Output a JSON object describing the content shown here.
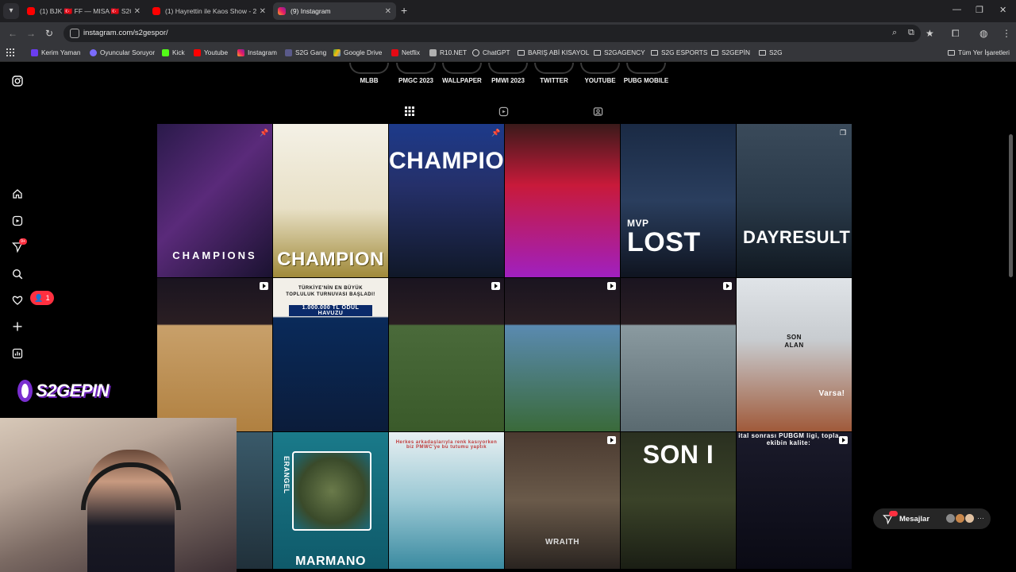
{
  "browser": {
    "tabs": [
      {
        "label": "(1) BJK 🇹🇷 FF — MISA 🇹🇷 S2G"
      },
      {
        "label": "(1) Hayrettin ile Kaos Show - 2."
      },
      {
        "label": "(9) Instagram"
      }
    ],
    "url": "instagram.com/s2gespor/",
    "bookmarks": [
      "Kerim Yaman",
      "Oyuncular Soruyor",
      "Kick",
      "Youtube",
      "Instagram",
      "S2G Gang",
      "Google Drive",
      "Netflix",
      "R10.NET",
      "ChatGPT",
      "BARIŞ ABİ KISAYOL",
      "S2GAGENCY",
      "S2G ESPORTS",
      "S2GEPİN",
      "S2G"
    ],
    "all_bookmarks": "Tüm Yer İşaretleri"
  },
  "instagram": {
    "highlights": [
      "MLBB",
      "PMGC 2023",
      "WALLPAPER",
      "PMWI 2023",
      "TWITTER",
      "YOUTUBE",
      "PUBG MOBILE"
    ],
    "notification_badge": "9+",
    "activity_count": "1",
    "overlay_logo": "S2GEPIN",
    "messages": {
      "label": "Mesajlar",
      "badge": "9+"
    },
    "posts": {
      "p1": "CHAMPIONS",
      "p2": "CHAMPION",
      "p3": "CHAMPION",
      "p5_a": "MVP",
      "p5_b": "LOST",
      "p6": "DAYRESULT",
      "p8_a": "TÜRKİYE'NİN EN BÜYÜK",
      "p8_b": "TOPLULUK TURNUVASI BAŞLADI!",
      "p8_c": "1.000.000 TL ÖDÜL HAVUZU",
      "p12_a": "SON",
      "p12_b": "ALAN",
      "p12_c": "Varsa!",
      "p14": "ERANGEL",
      "p14_b": "MARMANO",
      "p15": "Herkes arkadaşlarıyla renk kasıyorken biz PMWC'ye bu tutumu yaptık",
      "p16": "WRAITH",
      "p17": "SON I",
      "p18": "ital sonrası PUBGM ligi, topla ekibin kalite:"
    }
  },
  "colors": {
    "accent_red": "#ff3040",
    "purple": "#7a2fd0",
    "bg": "#000000"
  }
}
